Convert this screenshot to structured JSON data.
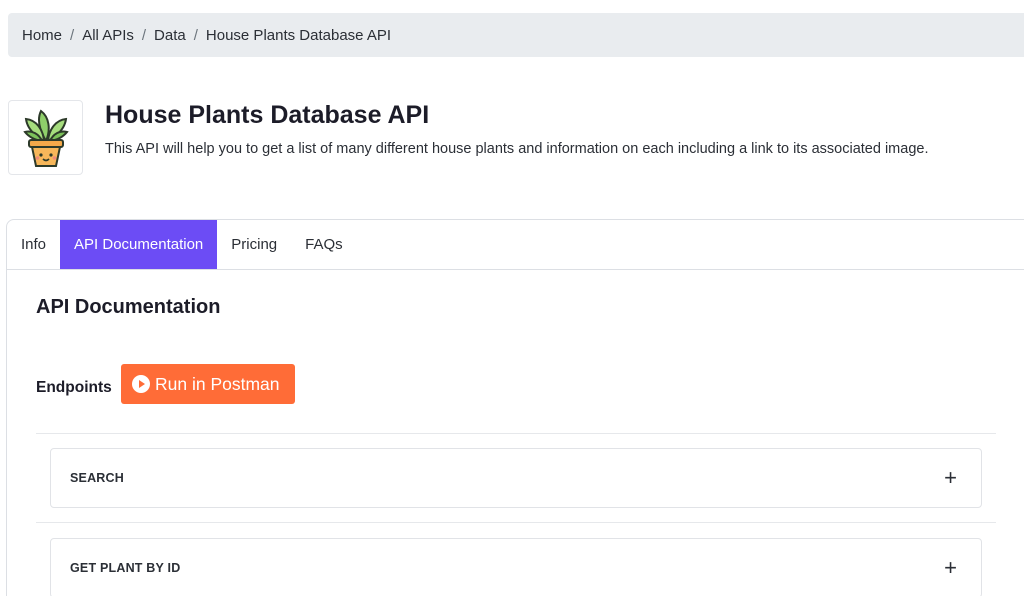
{
  "breadcrumb": {
    "items": [
      "Home",
      "All APIs",
      "Data",
      "House Plants Database API"
    ],
    "separator": "/"
  },
  "api": {
    "logo_icon": "potted-plant-icon",
    "title": "House Plants Database API",
    "description": "This API will help you to get a list of many different house plants and information on each including a link to its associated image."
  },
  "tabs": [
    {
      "label": "Info",
      "active": false
    },
    {
      "label": "API Documentation",
      "active": true
    },
    {
      "label": "Pricing",
      "active": false
    },
    {
      "label": "FAQs",
      "active": false
    }
  ],
  "documentation": {
    "heading": "API Documentation",
    "endpoints_label": "Endpoints",
    "postman_button": "Run in Postman",
    "sections": [
      {
        "label": "SEARCH",
        "toggle": "+"
      },
      {
        "label": "GET PLANT BY ID",
        "toggle": "+"
      }
    ]
  },
  "colors": {
    "accent": "#6c4cf5",
    "postman": "#ff6c37",
    "breadcrumb_bg": "#e9ecef"
  }
}
